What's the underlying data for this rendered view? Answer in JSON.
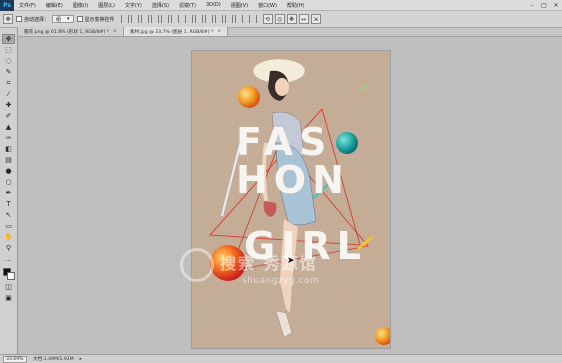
{
  "app": {
    "logo": "Ps"
  },
  "menu": {
    "items": [
      "文件(F)",
      "编辑(E)",
      "图像(I)",
      "图层(L)",
      "文字(Y)",
      "选择(S)",
      "滤镜(T)",
      "3D(D)",
      "视图(V)",
      "窗口(W)",
      "帮助(H)"
    ]
  },
  "window_controls": [
    "–",
    "□",
    "✕"
  ],
  "options_bar": {
    "auto_select_label": "自动选择：",
    "auto_select_value": "组",
    "transform_label": "显示变换控件"
  },
  "tabs": [
    {
      "label": "服装.png @ 61.8% (形状 1, RGB/8#) *",
      "active": false
    },
    {
      "label": "素材.jpg @ 33.7% (图层 1, RGB/8#) *",
      "active": true
    }
  ],
  "tools": [
    {
      "name": "move-tool-icon",
      "glyph": "✥"
    },
    {
      "name": "marquee-tool-icon",
      "glyph": "⬚"
    },
    {
      "name": "lasso-tool-icon",
      "glyph": "◌"
    },
    {
      "name": "quick-select-tool-icon",
      "glyph": "✎"
    },
    {
      "name": "crop-tool-icon",
      "glyph": "⌗"
    },
    {
      "name": "eyedropper-tool-icon",
      "glyph": "⁄"
    },
    {
      "name": "healing-tool-icon",
      "glyph": "✚"
    },
    {
      "name": "brush-tool-icon",
      "glyph": "✐"
    },
    {
      "name": "stamp-tool-icon",
      "glyph": "▲"
    },
    {
      "name": "history-brush-icon",
      "glyph": "✑"
    },
    {
      "name": "eraser-tool-icon",
      "glyph": "◧"
    },
    {
      "name": "gradient-tool-icon",
      "glyph": "▤"
    },
    {
      "name": "blur-tool-icon",
      "glyph": "●"
    },
    {
      "name": "dodge-tool-icon",
      "glyph": "○"
    },
    {
      "name": "pen-tool-icon",
      "glyph": "✒"
    },
    {
      "name": "type-tool-icon",
      "glyph": "T"
    },
    {
      "name": "path-select-tool-icon",
      "glyph": "↖"
    },
    {
      "name": "shape-tool-icon",
      "glyph": "▭"
    },
    {
      "name": "hand-tool-icon",
      "glyph": "✋"
    },
    {
      "name": "zoom-tool-icon",
      "glyph": "⚲"
    },
    {
      "name": "more-tools-icon",
      "glyph": "…"
    }
  ],
  "document": {
    "line1": "FAS HON",
    "line2": "GIRL"
  },
  "watermark": {
    "cn": "搜索 秀源馆",
    "url": "shuangzyg.com"
  },
  "status": {
    "zoom": "33.69%",
    "doc_info": "文档:1.49M/1.92M"
  },
  "colors": {
    "document_bg": "#c3ab95",
    "menubar": "#dcdcdc",
    "workspace": "#bfbfbf",
    "ps_accent": "#4fb1ff"
  }
}
